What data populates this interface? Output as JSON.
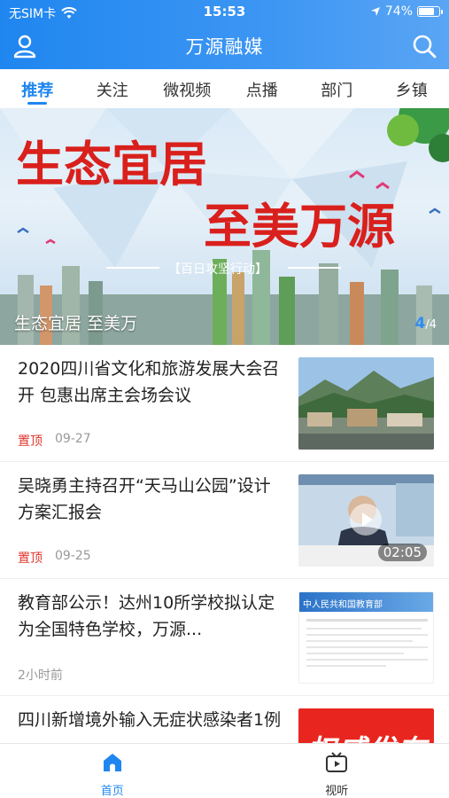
{
  "status_bar": {
    "carrier": "无SIM卡",
    "time": "15:53",
    "battery": "74%",
    "battery_level": 0.74
  },
  "header": {
    "title": "万源融媒"
  },
  "tabs": [
    {
      "label": "推荐",
      "active": true
    },
    {
      "label": "关注"
    },
    {
      "label": "微视频"
    },
    {
      "label": "点播"
    },
    {
      "label": "部门"
    },
    {
      "label": "乡镇"
    }
  ],
  "banner": {
    "image_text_line1": "生态宜居",
    "image_text_line2": "至美万源",
    "image_subtext": "【百日攻坚行动】",
    "caption": "生态宜居  至美万",
    "counter_current": "4",
    "counter_total": "/4"
  },
  "news": [
    {
      "title": "2020四川省文化和旅游发展大会召开 包惠出席主会场会议",
      "pin": "置顶",
      "date": "09-27",
      "thumb": "mountain-town-photo"
    },
    {
      "title": "吴晓勇主持召开“天马山公园”设计方案汇报会",
      "pin": "置顶",
      "date": "09-25",
      "thumb": "meeting-video",
      "duration": "02:05"
    },
    {
      "title": "教育部公示！达州10所学校拟认定为全国特色学校，万源...",
      "pin": "",
      "date": "2小时前",
      "thumb": "document-screenshot",
      "thumb_text": "中人民共和国教育部"
    },
    {
      "title": "四川新增境外输入无症状感染者1例",
      "pin": "",
      "date": "",
      "thumb": "red-poster",
      "thumb_text": "权威发布"
    }
  ],
  "bottom_nav": [
    {
      "label": "首页",
      "icon": "home-icon",
      "active": true
    },
    {
      "label": "视听",
      "icon": "tv-icon",
      "active": false
    }
  ],
  "colors": {
    "brand": "#1f86f0",
    "pin": "#e0372e",
    "banner_text": "#d9201c"
  }
}
